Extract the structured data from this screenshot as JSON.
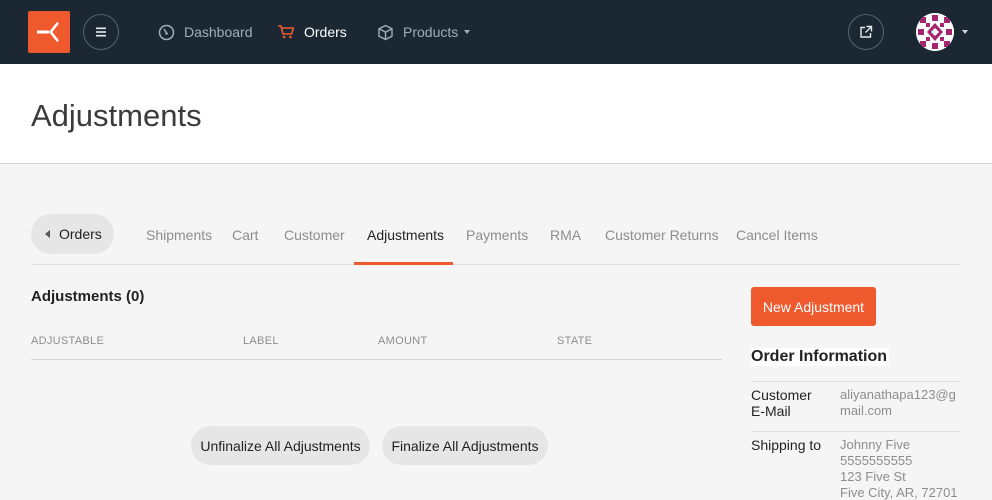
{
  "nav": {
    "dashboard": "Dashboard",
    "orders": "Orders",
    "products": "Products"
  },
  "colors": {
    "topbar": "#1b2834",
    "accent": "#ee5a2e",
    "active_tab_underline": "#ee5a2e"
  },
  "icons": {
    "logo": "solidus-logo",
    "menu": "hamburger-icon",
    "dashboard": "speedometer-icon",
    "orders": "shopping-cart-icon",
    "products": "box-icon",
    "external": "external-link-icon",
    "avatar": "user-avatar"
  },
  "page": {
    "title": "Adjustments"
  },
  "tabs": {
    "back": "Orders",
    "items": [
      "Shipments",
      "Cart",
      "Customer",
      "Adjustments",
      "Payments",
      "RMA",
      "Customer Returns",
      "Cancel Items"
    ],
    "active": "Adjustments"
  },
  "adjustments": {
    "title": "Adjustments (0)",
    "columns": [
      "ADJUSTABLE",
      "LABEL",
      "AMOUNT",
      "STATE"
    ],
    "unfinalize_label": "Unfinalize All Adjustments",
    "finalize_label": "Finalize All Adjustments"
  },
  "sidebar": {
    "new_adjustment_label": "New Adjustment",
    "order_info_title": "Order Information",
    "customer_email_label_1": "Customer",
    "customer_email_label_2": "E-Mail",
    "customer_email_value_1": "aliyanathapa123@g",
    "customer_email_value_2": "mail.com",
    "shipping_label": "Shipping to",
    "shipping_lines": [
      "Johnny Five",
      "5555555555",
      "123 Five St",
      "Five City, AR, 72701"
    ]
  }
}
